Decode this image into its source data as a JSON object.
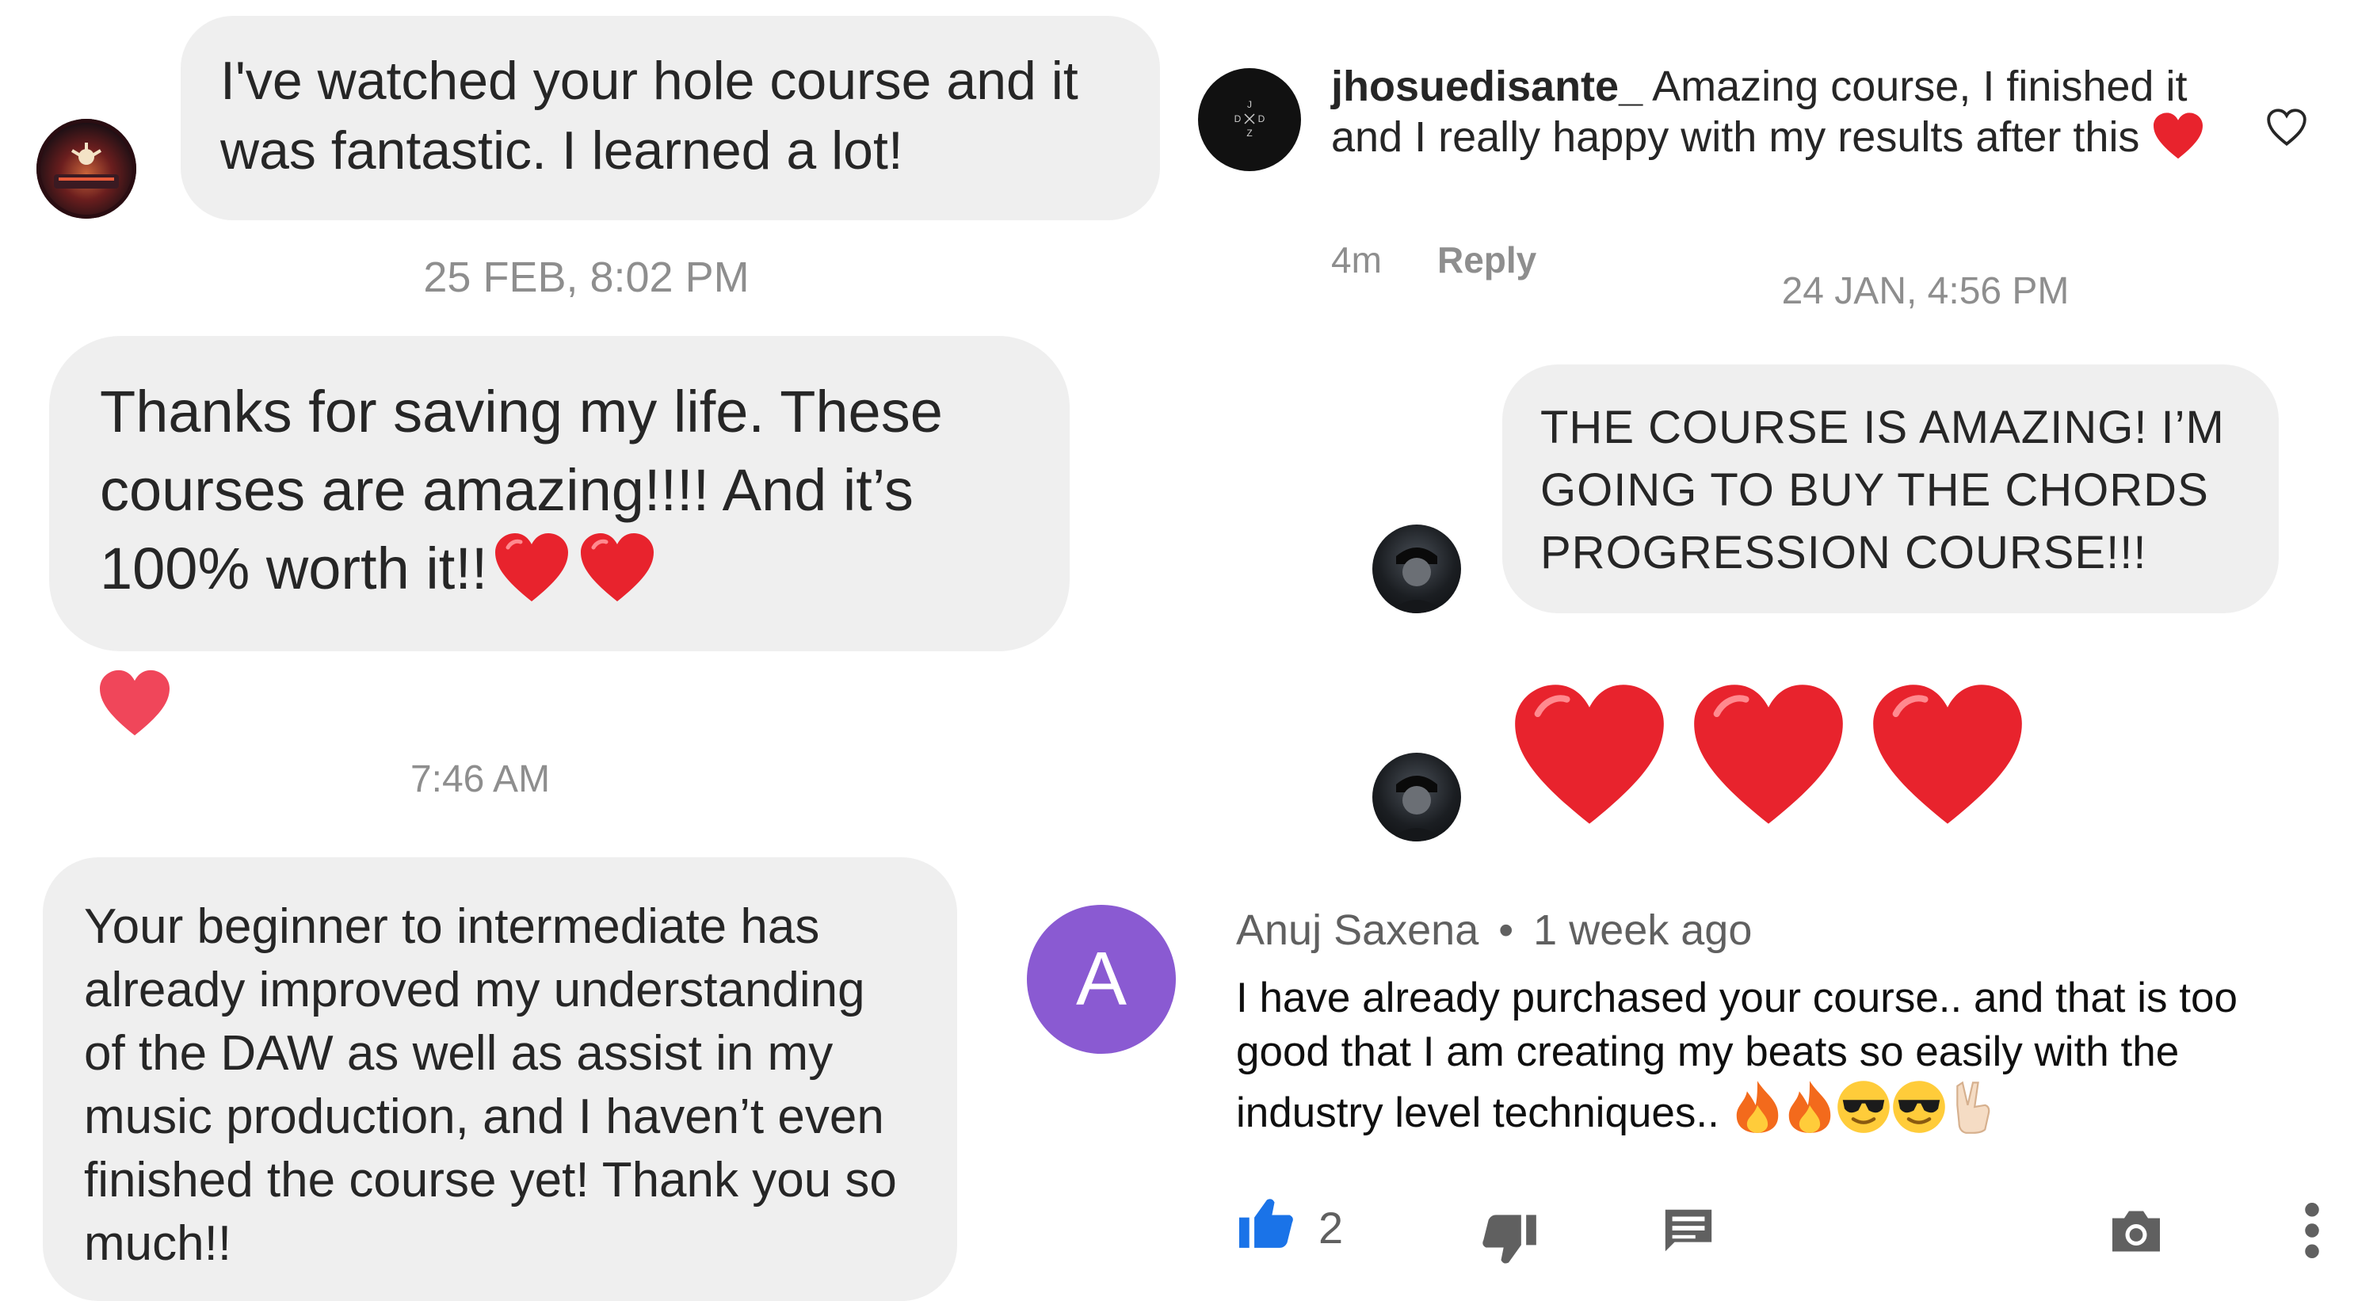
{
  "chat_left": {
    "message_1": "I've watched your hole course and it was fantastic. I learned a lot!",
    "timestamp_1": "25 FEB, 8:02 PM",
    "message_2": "Thanks for saving my life. These courses are amazing!!!! And it’s 100% worth it!!",
    "message_2_reaction": "heart-icon",
    "timestamp_2": "7:46 AM",
    "message_3": "Your beginner to intermediate has already improved my understanding of the DAW as well as assist in my music production, and I haven’t even finished the course yet! Thank you so much!!"
  },
  "instagram_comment": {
    "username": "jhosuedisante_",
    "text": "Amazing course,  I finished it and I really happy with my results after this",
    "time": "4m",
    "reply_label": "Reply",
    "avatar_letters": [
      "J",
      "D",
      "X",
      "D",
      "Z"
    ]
  },
  "chat_right": {
    "timestamp": "24 JAN, 4:56 PM",
    "message_1": "THE COURSE IS AMAZING! I’M GOING TO BUY THE CHORDS PROGRESSION COURSE!!!",
    "message_2_emoji": [
      "heart",
      "heart",
      "heart"
    ]
  },
  "youtube_comment": {
    "author": "Anuj Saxena",
    "separator": "•",
    "time": "1 week ago",
    "avatar_letter": "A",
    "text": "I have already purchased your course.. and that is too good that I am creating my beats so easily with the industry level techniques..",
    "like_count": "2",
    "colors": {
      "avatar": "#8a5ad2",
      "like": "#1a73e8",
      "heart": "#f0465a"
    }
  }
}
